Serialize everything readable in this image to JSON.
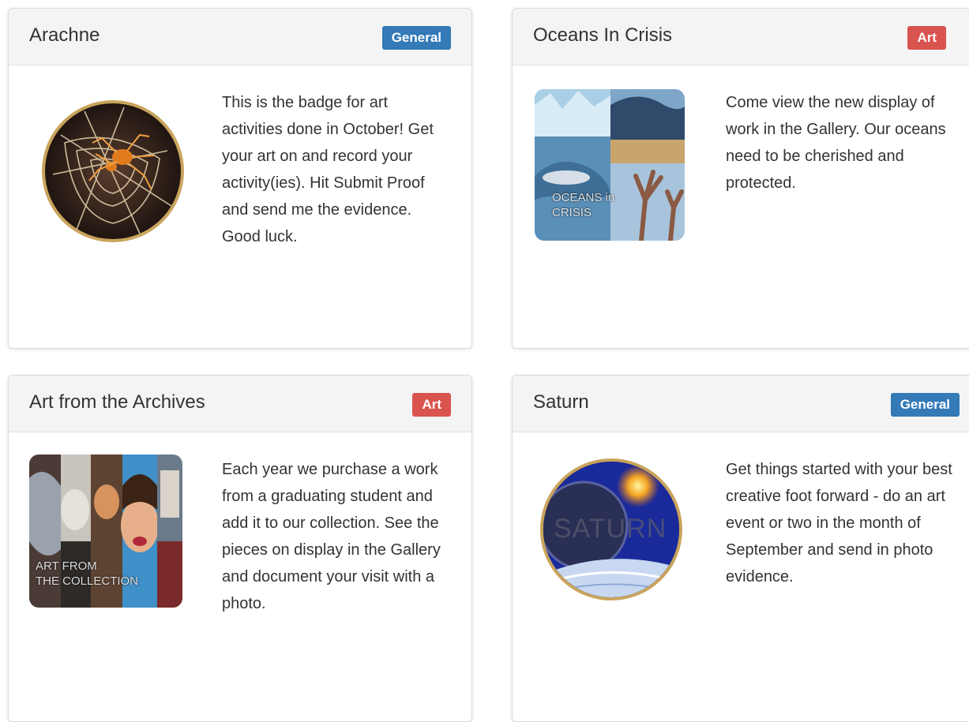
{
  "cards": [
    {
      "title": "Arachne",
      "badge": "General",
      "badge_color": "#337ab7",
      "image_icon": "spider-web-icon",
      "description": "This is the badge for art activities done in October! Get your art on and record your activity(ies). Hit Submit Proof and send me the evidence. Good luck."
    },
    {
      "title": "Oceans In Crisis",
      "badge": "Art",
      "badge_color": "#d9534f",
      "image_icon": "ocean-collage-icon",
      "image_caption_line1": "OCEANS in",
      "image_caption_line2": "CRISIS",
      "description": "Come view the new display of work in the Gallery. Our oceans need to be cherished and protected."
    },
    {
      "title": "Art from the Archives",
      "badge": "Art",
      "badge_color": "#d9534f",
      "image_icon": "portrait-collage-icon",
      "image_caption_line1": "ART FROM",
      "image_caption_line2": "THE COLLECTION",
      "description": "Each year we purchase a work from a graduating student and add it to our collection. See the pieces on display in the Gallery and document your visit with a photo."
    },
    {
      "title": "Saturn",
      "badge": "General",
      "badge_color": "#337ab7",
      "image_icon": "planet-icon",
      "image_caption_line1": "SATURN",
      "description": "Get things started with your best creative foot forward - do an art event or two in the month of September and send in photo evidence."
    }
  ]
}
